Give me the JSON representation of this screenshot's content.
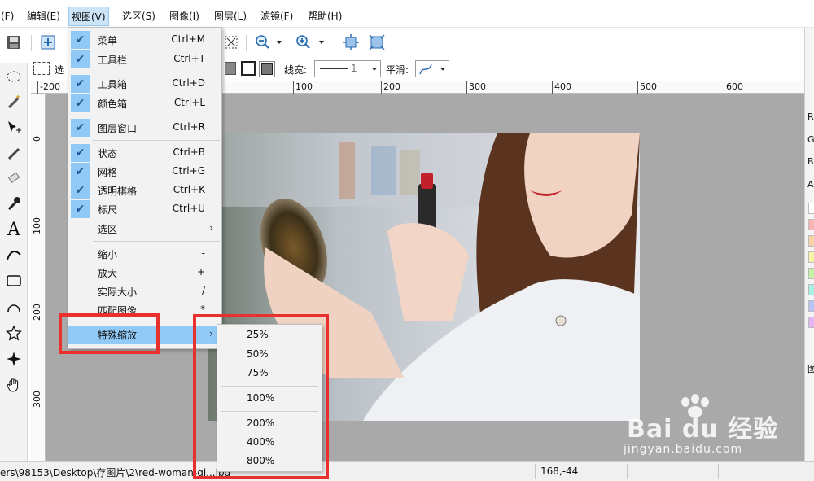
{
  "menubar": {
    "items": [
      "(F)",
      "编辑(E)",
      "视图(V)",
      "选区(S)",
      "图像(I)",
      "图层(L)",
      "滤镜(F)",
      "帮助(H)"
    ]
  },
  "toolbar2": {
    "select_label": "选",
    "linewidth_label": "线宽:",
    "linewidth_value": "1",
    "smooth_label": "平滑:"
  },
  "ruler": {
    "h_labels": [
      "-200",
      "100",
      "200",
      "300",
      "400",
      "500",
      "600"
    ],
    "v_labels": [
      "0",
      "100",
      "200",
      "300"
    ]
  },
  "view_menu": {
    "items": [
      {
        "label": "菜单",
        "shortcut": "Ctrl+M",
        "checked": true
      },
      {
        "label": "工具栏",
        "shortcut": "Ctrl+T",
        "checked": true
      },
      {
        "label": "工具箱",
        "shortcut": "Ctrl+D",
        "checked": true
      },
      {
        "label": "颜色箱",
        "shortcut": "Ctrl+L",
        "checked": true
      },
      {
        "label": "图层窗口",
        "shortcut": "Ctrl+R",
        "checked": true
      },
      {
        "label": "状态",
        "shortcut": "Ctrl+B",
        "checked": true
      },
      {
        "label": "网格",
        "shortcut": "Ctrl+G",
        "checked": true
      },
      {
        "label": "透明棋格",
        "shortcut": "Ctrl+K",
        "checked": true
      },
      {
        "label": "标尺",
        "shortcut": "Ctrl+U",
        "checked": true
      },
      {
        "label": "选区",
        "shortcut": "›",
        "checked": false
      },
      {
        "label": "缩小",
        "shortcut": "-",
        "checked": false
      },
      {
        "label": "放大",
        "shortcut": "+",
        "checked": false
      },
      {
        "label": "实际大小",
        "shortcut": "/",
        "checked": false
      },
      {
        "label": "匹配图像",
        "shortcut": "*",
        "checked": false
      },
      {
        "label": "特殊缩放",
        "shortcut": "›",
        "checked": false
      }
    ]
  },
  "zoom_submenu": {
    "items": [
      "25%",
      "50%",
      "75%",
      "100%",
      "200%",
      "400%",
      "800%"
    ]
  },
  "rightpanel": {
    "labels": [
      "R",
      "G",
      "B",
      "A",
      "图"
    ]
  },
  "status": {
    "path": "ers\\98153\\Desktop\\存图片\\2\\red-woman-gi...jpg",
    "coords": "168,-44"
  },
  "watermark": {
    "brand": "Bai du 经验",
    "url": "jingyan.baidu.com"
  },
  "colors": {
    "menu_highlight": "#91c9f7",
    "annotation_red": "#e8312e",
    "canvas_bg": "#a9a9a9"
  }
}
